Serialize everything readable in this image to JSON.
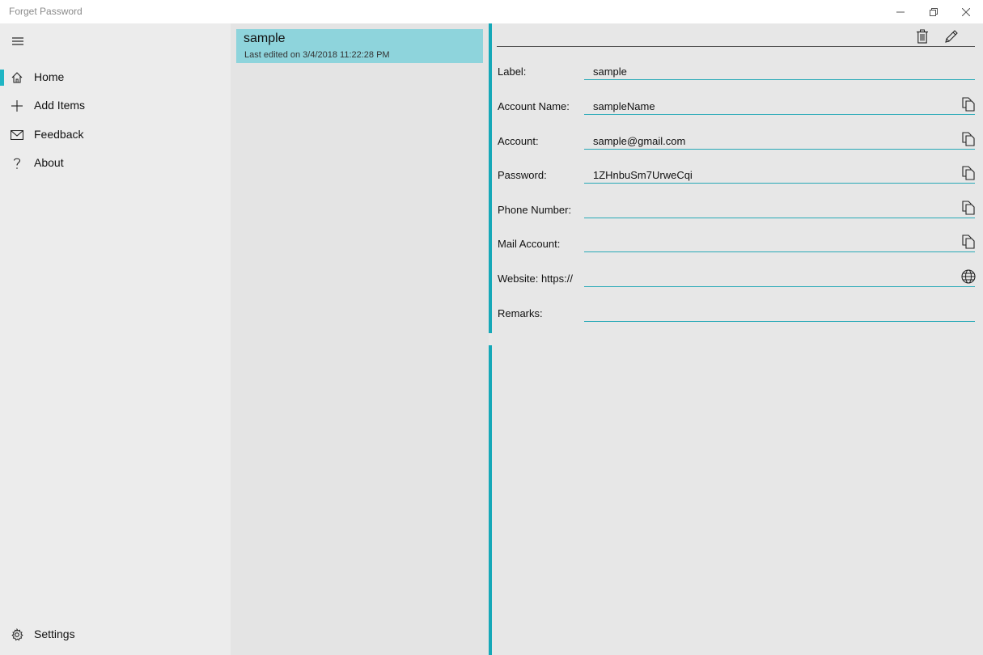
{
  "window": {
    "title": "Forget Password"
  },
  "nav": {
    "items": [
      {
        "label": "Home",
        "icon": "home-icon",
        "selected": true
      },
      {
        "label": "Add Items",
        "icon": "plus-icon",
        "selected": false
      },
      {
        "label": "Feedback",
        "icon": "mail-icon",
        "selected": false
      },
      {
        "label": "About",
        "icon": "question-icon",
        "selected": false
      }
    ],
    "settings": {
      "label": "Settings",
      "icon": "gear-icon"
    }
  },
  "list": {
    "items": [
      {
        "title": "sample",
        "subtitle": "Last edited on 3/4/2018 11:22:28 PM"
      }
    ]
  },
  "detail": {
    "toolbar": {
      "delete_icon": "trash-icon",
      "edit_icon": "pencil-icon"
    },
    "fields": [
      {
        "label": "Label:",
        "value": "sample",
        "icon": ""
      },
      {
        "label": "Account Name:",
        "value": "sampleName",
        "icon": "copy-icon"
      },
      {
        "label": "Account:",
        "value": "sample@gmail.com",
        "icon": "copy-icon"
      },
      {
        "label": "Password:",
        "value": "1ZHnbuSm7UrweCqi",
        "icon": "copy-icon"
      },
      {
        "label": "Phone Number:",
        "value": "",
        "icon": "copy-icon"
      },
      {
        "label": "Mail Account:",
        "value": "",
        "icon": "copy-icon"
      },
      {
        "label": "Website: https://",
        "value": "",
        "icon": "globe-icon"
      },
      {
        "label": "Remarks:",
        "value": "",
        "icon": ""
      }
    ]
  },
  "colors": {
    "accent": "#15a8b8",
    "selection": "#8ed4dc"
  }
}
